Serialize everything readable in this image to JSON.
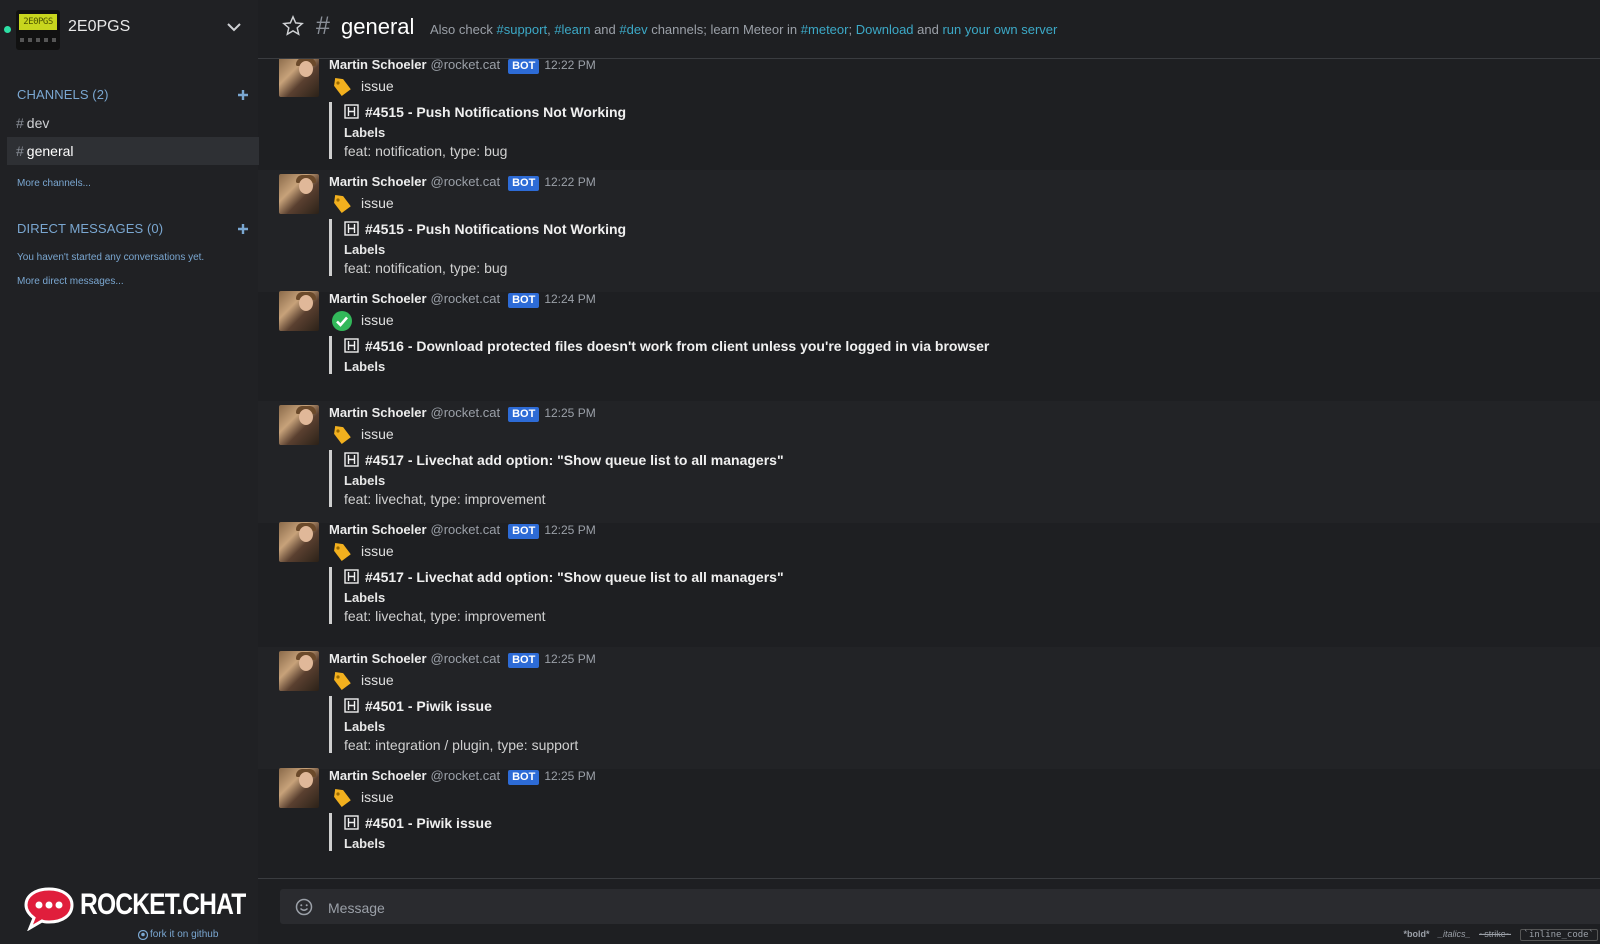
{
  "sidebar": {
    "username": "2E0PGS",
    "avatar_text": "2E0PGS",
    "channels_title": "CHANNELS (2)",
    "channels": [
      {
        "hash": "#",
        "name": "dev"
      },
      {
        "hash": "#",
        "name": "general"
      }
    ],
    "more_channels": "More channels...",
    "dm_title": "DIRECT MESSAGES (0)",
    "dm_empty": "You haven't started any conversations yet.",
    "more_dms": "More direct messages...",
    "brand": "ROCKET.CHAT",
    "fork_link": "fork it on github"
  },
  "header": {
    "room_hash": "#",
    "room_name": "general",
    "topic": {
      "t1": "Also check ",
      "l1": "#support",
      "t2": ", ",
      "l2": "#learn",
      "t3": " and ",
      "l3": "#dev",
      "t4": " channels; learn Meteor in ",
      "l4": "#meteor",
      "t5": "; ",
      "l5": "Download",
      "t6": " and ",
      "l6": "run your own server"
    }
  },
  "messages": [
    {
      "user": "Martin Schoeler",
      "handle": "@rocket.cat",
      "badge": "BOT",
      "time": "12:22 PM",
      "emoji": "tag",
      "text": "issue",
      "attachment": {
        "title": "#4515 - Push Notifications Not Working",
        "label": "Labels",
        "value": "feat: notification, type: bug"
      }
    },
    {
      "user": "Martin Schoeler",
      "handle": "@rocket.cat",
      "badge": "BOT",
      "time": "12:22 PM",
      "emoji": "tag",
      "text": "issue",
      "attachment": {
        "title": "#4515 - Push Notifications Not Working",
        "label": "Labels",
        "value": "feat: notification, type: bug"
      }
    },
    {
      "user": "Martin Schoeler",
      "handle": "@rocket.cat",
      "badge": "BOT",
      "time": "12:24 PM",
      "emoji": "check",
      "text": "issue",
      "attachment": {
        "title": "#4516 - Download protected files doesn't work from client unless you're logged in via browser",
        "label": "Labels",
        "value": ""
      }
    },
    {
      "user": "Martin Schoeler",
      "handle": "@rocket.cat",
      "badge": "BOT",
      "time": "12:25 PM",
      "emoji": "tag",
      "text": "issue",
      "attachment": {
        "title": "#4517 - Livechat add option: \"Show queue list to all managers\"",
        "label": "Labels",
        "value": "feat: livechat, type: improvement"
      }
    },
    {
      "user": "Martin Schoeler",
      "handle": "@rocket.cat",
      "badge": "BOT",
      "time": "12:25 PM",
      "emoji": "tag",
      "text": "issue",
      "attachment": {
        "title": "#4517 - Livechat add option: \"Show queue list to all managers\"",
        "label": "Labels",
        "value": "feat: livechat, type: improvement"
      }
    },
    {
      "user": "Martin Schoeler",
      "handle": "@rocket.cat",
      "badge": "BOT",
      "time": "12:25 PM",
      "emoji": "tag",
      "text": "issue",
      "attachment": {
        "title": "#4501 - Piwik issue",
        "label": "Labels",
        "value": "feat: integration / plugin, type: support"
      }
    },
    {
      "user": "Martin Schoeler",
      "handle": "@rocket.cat",
      "badge": "BOT",
      "time": "12:25 PM",
      "emoji": "tag",
      "text": "issue",
      "attachment": {
        "title": "#4501 - Piwik issue",
        "label": "Labels",
        "value": ""
      }
    }
  ],
  "composer": {
    "placeholder": "Message",
    "hints": {
      "bold": "*bold*",
      "italics": "_italics_",
      "strike": "~strike~",
      "code": "`inline_code`"
    }
  },
  "colors": {
    "link": "#3ca9c7",
    "bot_badge": "#2d6bd6",
    "status_online": "#2de0a5"
  }
}
